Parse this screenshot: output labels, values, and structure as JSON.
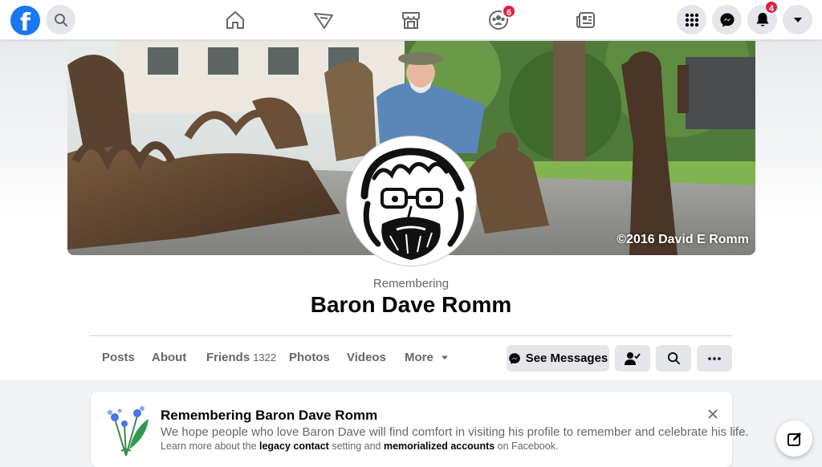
{
  "nav": {
    "home_badge": "",
    "groups_badge": "6",
    "notifications_badge": "4"
  },
  "cover": {
    "credit": "©2016 David E Romm"
  },
  "profile": {
    "remembering_label": "Remembering",
    "name": "Baron Dave Romm"
  },
  "tabs": [
    {
      "label": "Posts"
    },
    {
      "label": "About"
    },
    {
      "label": "Friends",
      "count": "1322"
    },
    {
      "label": "Photos"
    },
    {
      "label": "Videos"
    },
    {
      "label": "More"
    }
  ],
  "actions": {
    "see_messages": "See Messages"
  },
  "memorial": {
    "title": "Remembering Baron Dave Romm",
    "subtitle": "We hope people who love Baron Dave will find comfort in visiting his profile to remember and celebrate his life.",
    "learn_prefix": "Learn more about the ",
    "legacy_contact": "legacy contact",
    "learn_mid": " setting and ",
    "memorialized_accounts": "memorialized accounts",
    "learn_suffix": " on Facebook."
  },
  "colors": {
    "brand": "#1877f2",
    "badge": "#e41e3f"
  },
  "icons": [
    "facebook-logo-icon",
    "search-icon",
    "home-icon",
    "watch-icon",
    "marketplace-icon",
    "groups-icon",
    "news-icon",
    "menu-grid-icon",
    "messenger-icon",
    "bell-icon",
    "caret-down-icon",
    "flower-icon",
    "close-icon",
    "compose-icon"
  ]
}
